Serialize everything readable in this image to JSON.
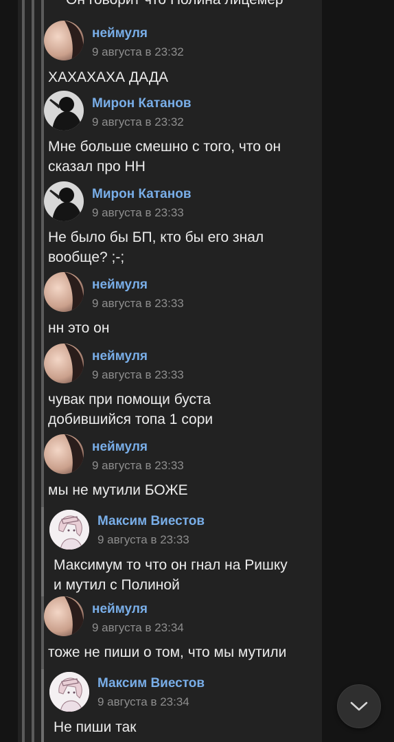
{
  "thread": {
    "top_partial_text": "Он говорит что Полина лицемер",
    "messages": [
      {
        "author": "неймуля",
        "time": "9 августа в 23:32",
        "text": "ХАХАХАХА ДАДА",
        "avatar": "avatar-neimulya"
      },
      {
        "author": "Мирон Катанов",
        "time": "9 августа в 23:32",
        "text": "Мне больше смешно с того, что он\nсказал про НН",
        "avatar": "avatar-miron"
      },
      {
        "author": "Мирон Катанов",
        "time": "9 августа в 23:33",
        "text": "Не было бы БП, кто бы его знал\nвообще? ;-;",
        "avatar": "avatar-miron"
      },
      {
        "author": "неймуля",
        "time": "9 августа в 23:33",
        "text": "нн это он",
        "avatar": "avatar-neimulya"
      },
      {
        "author": "неймуля",
        "time": "9 августа в 23:33",
        "text": "чувак при помощи буста\nдобившийся топа 1 сори",
        "avatar": "avatar-neimulya"
      },
      {
        "author": "неймуля",
        "time": "9 августа в 23:33",
        "text": "мы не мутили БОЖЕ",
        "avatar": "avatar-neimulya"
      },
      {
        "author": "Максим Виестов",
        "time": "9 августа в 23:33",
        "text": "Максимум то что он гнал на Ришку\nи мутил с Полиной",
        "avatar": "avatar-maxim"
      },
      {
        "author": "неймуля",
        "time": "9 августа в 23:34",
        "text": "тоже не пиши о том, что мы мутили",
        "avatar": "avatar-neimulya"
      },
      {
        "author": "Максим Виестов",
        "time": "9 августа в 23:34",
        "text": "Не пиши так",
        "avatar": "avatar-maxim"
      }
    ]
  },
  "scroll_button": {
    "icon": "chevron-down-icon"
  },
  "colors": {
    "background": "#141414",
    "panel": "#222222",
    "author_name": "#79aee8",
    "timestamp": "#8e8e8e",
    "message_text": "#ececec"
  }
}
